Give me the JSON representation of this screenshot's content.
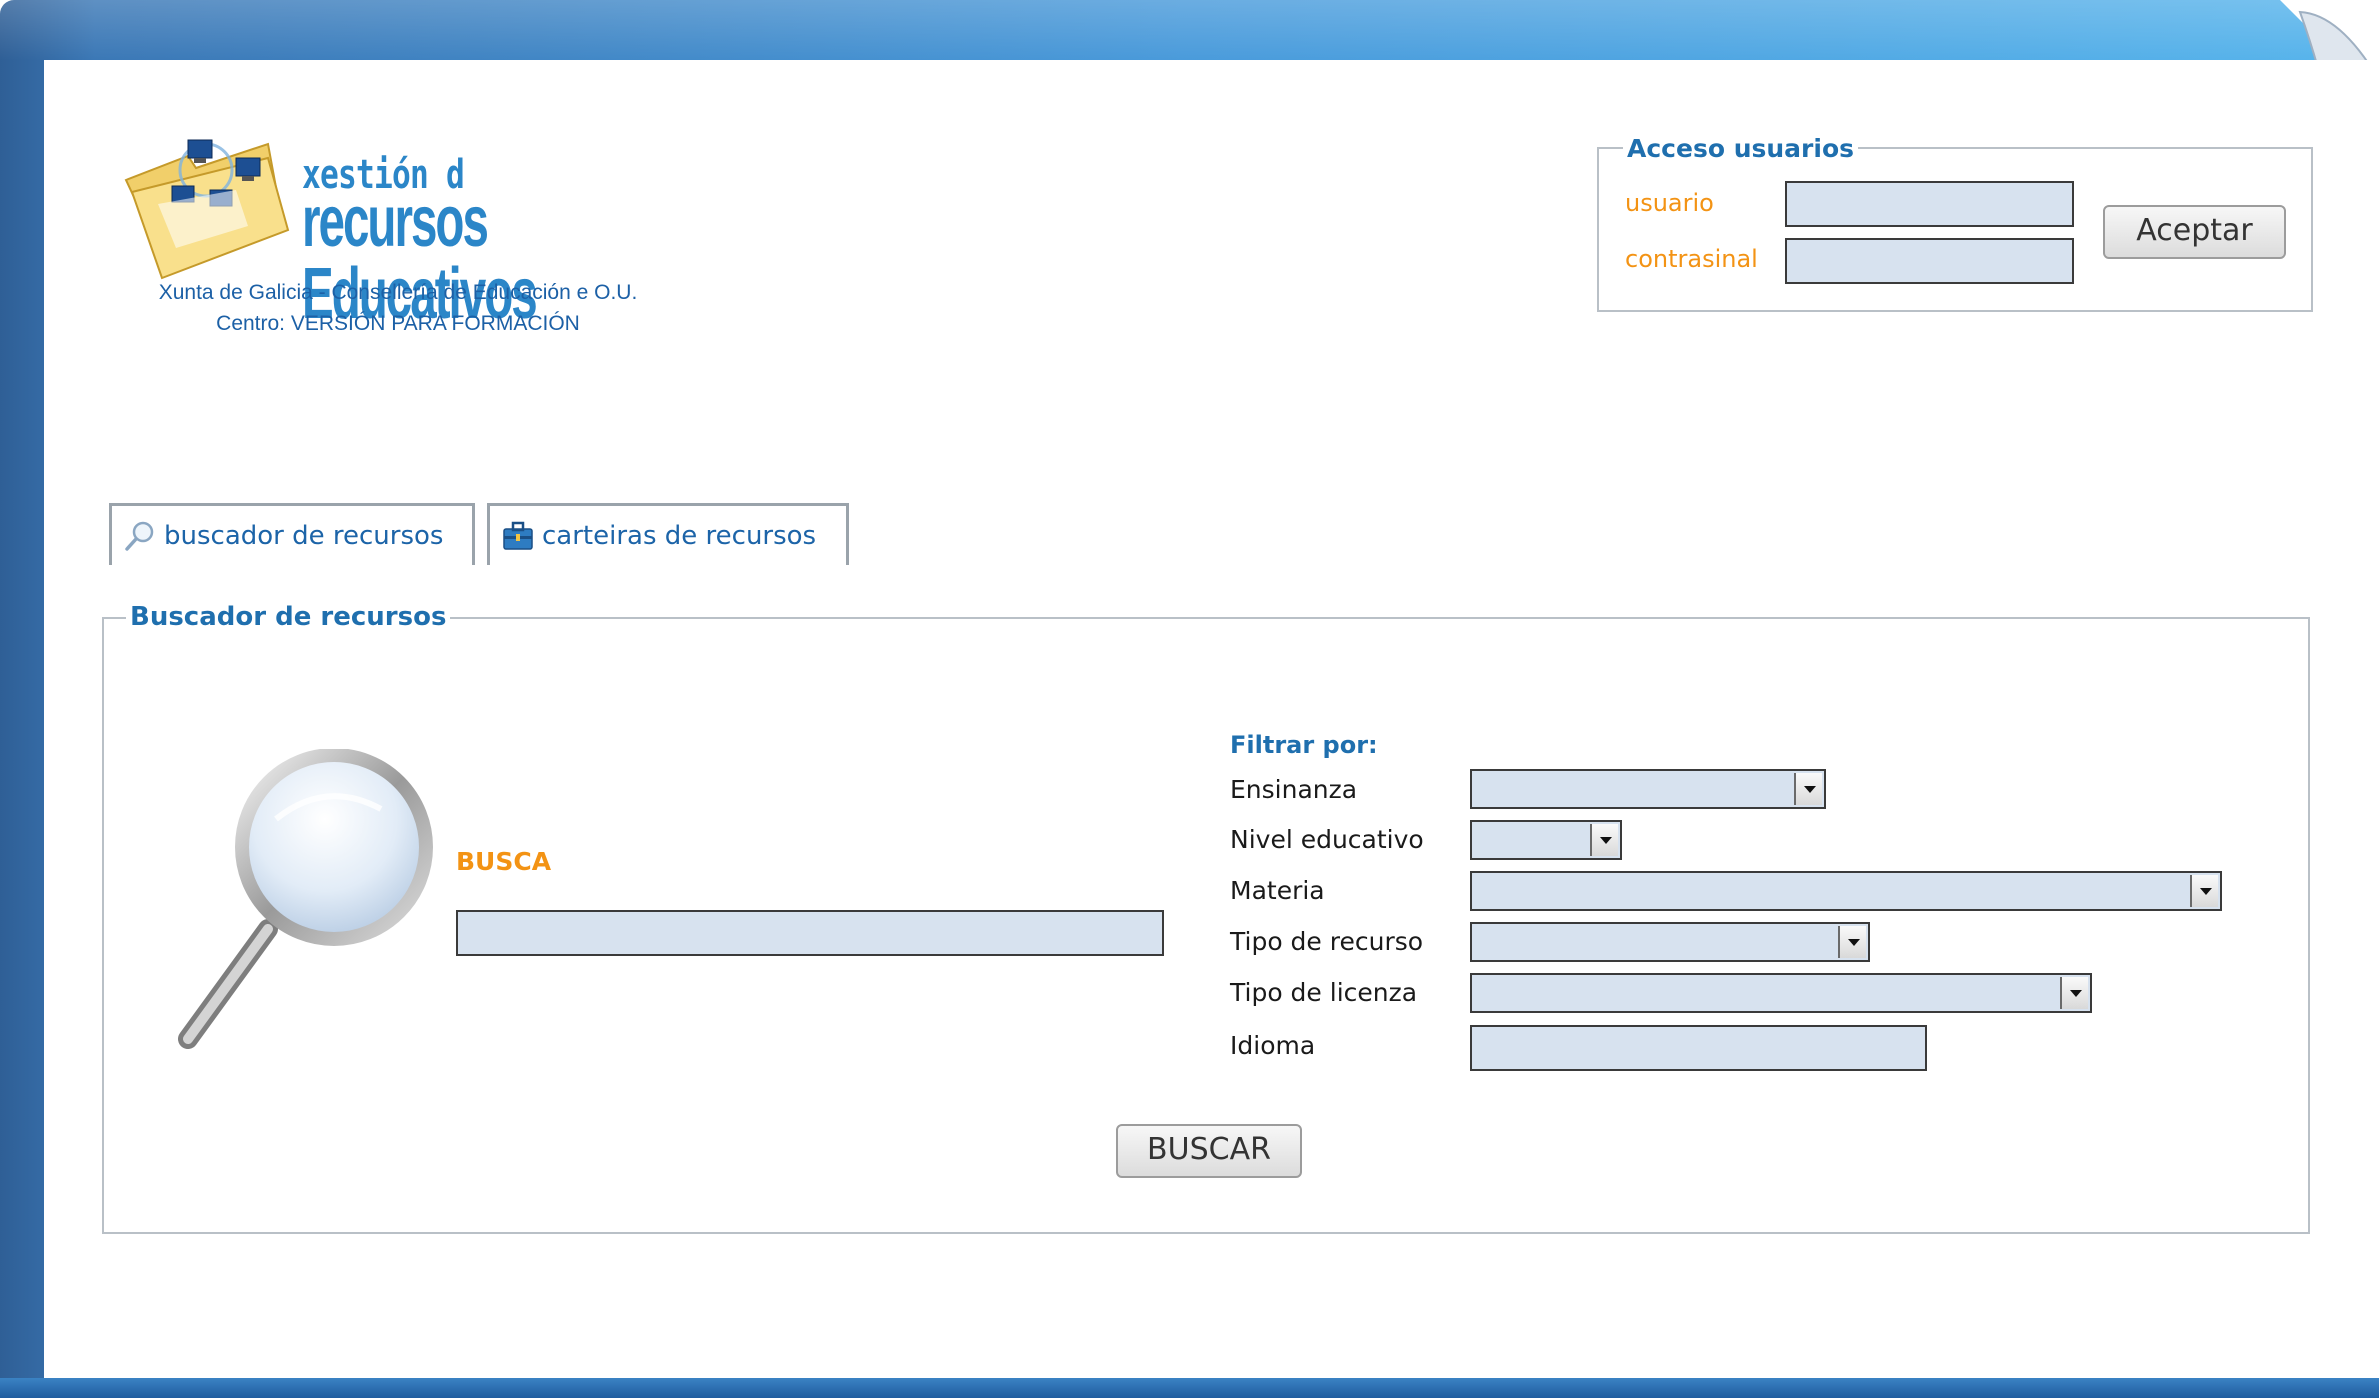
{
  "logo": {
    "title_line1": "xestión d",
    "title_line2": "recursos Educativos",
    "subtitle_line1": "Xunta de Galicia - Consellería de Educación e O.U.",
    "subtitle_line2": "Centro: VERSIÓN PARA FORMACIÓN"
  },
  "login": {
    "legend": "Acceso usuarios",
    "user_label": "usuario",
    "user_value": "",
    "password_label": "contrasinal",
    "password_value": "",
    "submit_label": "Aceptar"
  },
  "tabs": [
    {
      "label": "buscador de recursos",
      "icon": "search-icon"
    },
    {
      "label": "carteiras de recursos",
      "icon": "briefcase-icon"
    }
  ],
  "search": {
    "legend": "Buscador de recursos",
    "busca_label": "BUSCA",
    "busca_value": "",
    "filter_title": "Filtrar por:",
    "filters": [
      {
        "label": "Ensinanza",
        "value": ""
      },
      {
        "label": "Nivel educativo",
        "value": ""
      },
      {
        "label": "Materia",
        "value": ""
      },
      {
        "label": "Tipo de recurso",
        "value": ""
      },
      {
        "label": "Tipo de licenza",
        "value": ""
      },
      {
        "label": "Idioma",
        "value": ""
      }
    ],
    "submit_label": "BUSCAR"
  },
  "colors": {
    "frame_blue": "#4a9bdb",
    "link_blue": "#1f6fae",
    "accent_orange": "#f39314",
    "input_fill": "#d7e2ef"
  }
}
